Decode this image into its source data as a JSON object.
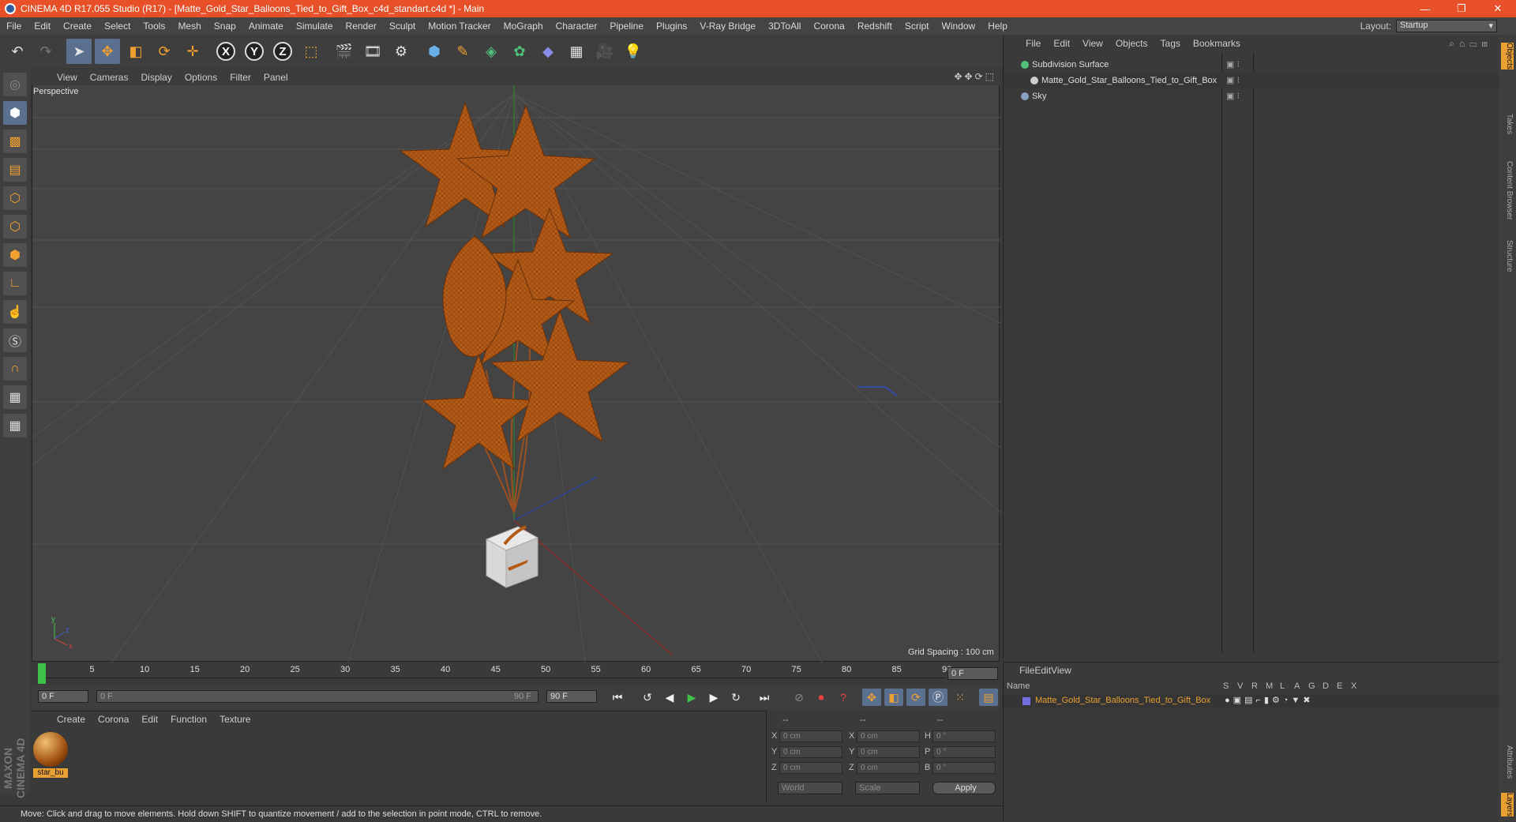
{
  "titlebar": {
    "title": "CINEMA 4D R17.055 Studio (R17) - [Matte_Gold_Star_Balloons_Tied_to_Gift_Box_c4d_standart.c4d *] - Main",
    "min": "—",
    "max": "❐",
    "close": "✕"
  },
  "menu": [
    "File",
    "Edit",
    "Create",
    "Select",
    "Tools",
    "Mesh",
    "Snap",
    "Animate",
    "Simulate",
    "Render",
    "Sculpt",
    "Motion Tracker",
    "MoGraph",
    "Character",
    "Pipeline",
    "Plugins",
    "V-Ray Bridge",
    "3DToAll",
    "Corona",
    "Redshift",
    "Script",
    "Window",
    "Help"
  ],
  "layout": {
    "label": "Layout:",
    "value": "Startup"
  },
  "viewport": {
    "menu": [
      "View",
      "Cameras",
      "Display",
      "Options",
      "Filter",
      "Panel"
    ],
    "label": "Perspective",
    "grid_spacing": "Grid Spacing : 100 cm"
  },
  "timeline": {
    "ticks": [
      "0",
      "5",
      "10",
      "15",
      "20",
      "25",
      "30",
      "35",
      "40",
      "45",
      "50",
      "55",
      "60",
      "65",
      "70",
      "75",
      "80",
      "85",
      "90"
    ],
    "current": "0 F",
    "start": "0 F",
    "range_start": "0 F",
    "range_end": "90 F",
    "end": "90 F"
  },
  "material": {
    "menu": [
      "Create",
      "Corona",
      "Edit",
      "Function",
      "Texture"
    ],
    "name": "star_bu"
  },
  "coords": {
    "headers": [
      "--",
      "--",
      "--"
    ],
    "rows": [
      {
        "a": "X",
        "av": "0 cm",
        "b": "X",
        "bv": "0 cm",
        "c": "H",
        "cv": "0 °"
      },
      {
        "a": "Y",
        "av": "0 cm",
        "b": "Y",
        "bv": "0 cm",
        "c": "P",
        "cv": "0 °"
      },
      {
        "a": "Z",
        "av": "0 cm",
        "b": "Z",
        "bv": "0 cm",
        "c": "B",
        "cv": "0 °"
      }
    ],
    "world": "World",
    "scale": "Scale",
    "apply": "Apply"
  },
  "status": "Move: Click and drag to move elements. Hold down SHIFT to quantize movement / add to the selection in point mode, CTRL to remove.",
  "objects": {
    "menu": [
      "File",
      "Edit",
      "View",
      "Objects",
      "Tags",
      "Bookmarks"
    ],
    "items": [
      {
        "name": "Subdivision Surface",
        "color": "#4fc07a"
      },
      {
        "name": "Matte_Gold_Star_Balloons_Tied_to_Gift_Box",
        "color": "#cccccc"
      },
      {
        "name": "Sky",
        "color": "#8aa0c0"
      }
    ]
  },
  "layers": {
    "menu": [
      "File",
      "Edit",
      "View"
    ],
    "name_header": "Name",
    "col_headers": [
      "S",
      "V",
      "R",
      "M",
      "L",
      "A",
      "G",
      "D",
      "E",
      "X"
    ],
    "row": "Matte_Gold_Star_Balloons_Tied_to_Gift_Box",
    "row_color": "#e8a030"
  },
  "righttabs": [
    "Objects",
    "Takes",
    "Content Browser",
    "Structure",
    "Attributes",
    "Layers"
  ],
  "branding": "MAXON CINEMA 4D",
  "colors": {
    "title": "#e8502a",
    "accent": "#5b6f8f",
    "balloon": "#b35a16"
  }
}
